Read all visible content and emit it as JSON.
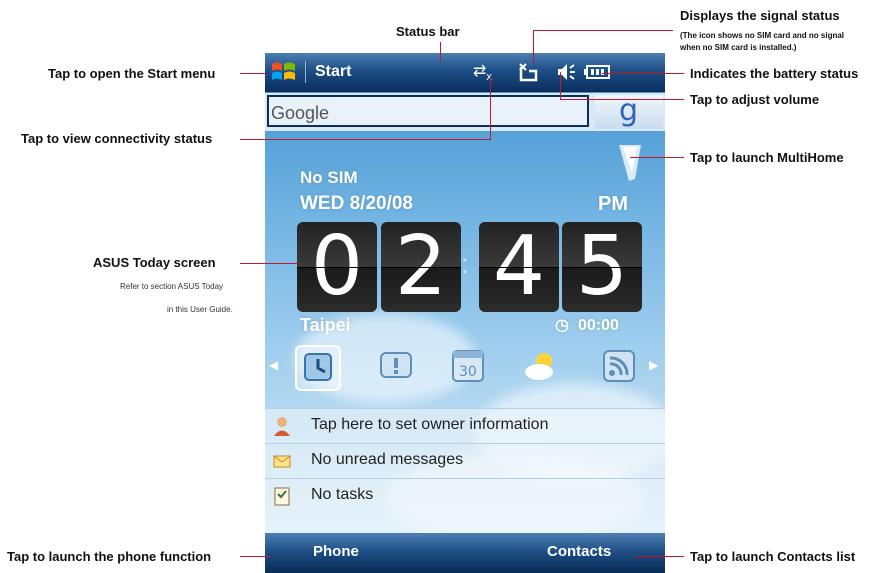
{
  "callouts": {
    "status_bar": "Status bar",
    "signal_status": "Displays the signal status",
    "signal_note_1": "(The icon shows no SIM card and no signal",
    "signal_note_2": "when no SIM card is installed.)",
    "start_menu": "Tap to open the Start menu",
    "battery": "Indicates the battery status",
    "volume": "Tap to adjust volume",
    "connectivity": "Tap to view connectivity status",
    "multihome": "Tap to launch MultiHome",
    "asus_today": "ASUS Today screen",
    "asus_note_1": "Refer to section ASUS Today",
    "asus_note_2": "in this User Guide.",
    "phone": "Tap to launch the phone function",
    "contacts": "Tap to launch Contacts list"
  },
  "device": {
    "start_label": "Start",
    "search_placeholder": "Google",
    "google_button": "g",
    "sim_status": "No SIM",
    "date": "WED 8/20/08",
    "ampm": "PM",
    "time_digits": [
      "0",
      "2",
      "4",
      "5"
    ],
    "city": "Taipei",
    "alarm_time": "00:00",
    "info_rows": [
      {
        "label": "Tap here to set owner information",
        "icon": "owner-icon"
      },
      {
        "label": "No unread messages",
        "icon": "message-icon"
      },
      {
        "label": "No tasks",
        "icon": "tasks-icon"
      }
    ],
    "softkeys": {
      "left": "Phone",
      "right": "Contacts"
    },
    "status_icons": [
      "connectivity-icon",
      "signal-icon",
      "volume-icon",
      "battery-icon"
    ]
  },
  "colors": {
    "leader": "#c0192c",
    "statusbar": "#1d4f86",
    "google_blue": "#2d63b8"
  }
}
